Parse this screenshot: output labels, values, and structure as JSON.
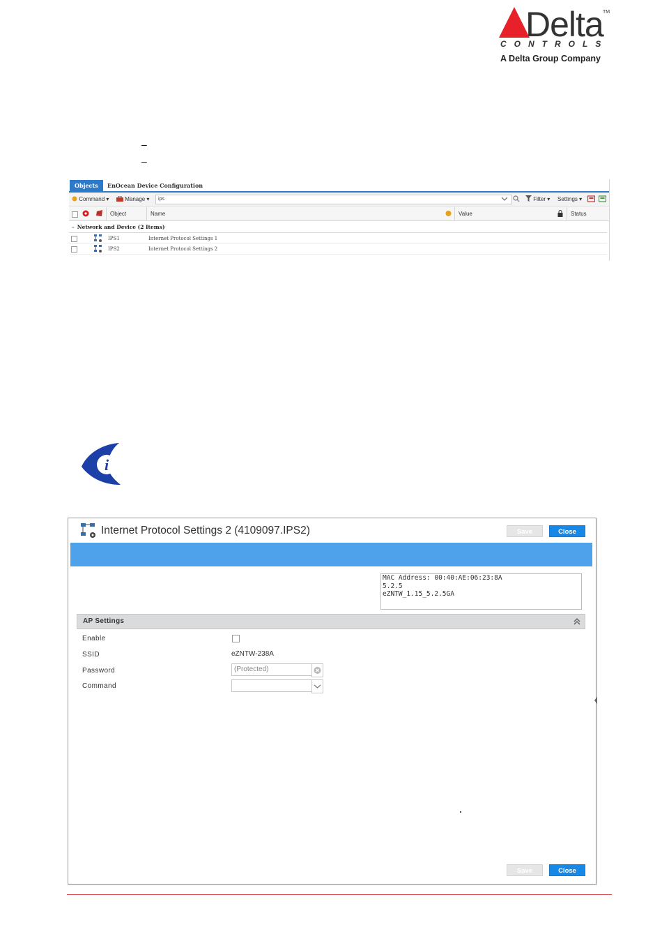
{
  "logo": {
    "brand": "Delta",
    "trademark": "TM",
    "subtitle": "CONTROLS",
    "company": "A Delta Group Company",
    "accent_color": "#e8202a"
  },
  "dashes": [
    "–",
    "–"
  ],
  "object_list": {
    "tabs": [
      {
        "label": "Objects",
        "active": true
      },
      {
        "label": "EnOcean Device Configuration",
        "active": false
      }
    ],
    "toolbar": {
      "command_label": "Command",
      "manage_label": "Manage",
      "search_value": "ips",
      "filter_label": "Filter",
      "settings_label": "Settings"
    },
    "columns": {
      "object": "Object",
      "name": "Name",
      "value": "Value",
      "status": "Status"
    },
    "group_label": "Network and Device (2 Items)",
    "rows": [
      {
        "object": "IPS1",
        "name": "Internet Protocol Settings 1"
      },
      {
        "object": "IPS2",
        "name": "Internet Protocol Settings 2"
      }
    ]
  },
  "info_icon": "info-icon",
  "dialog": {
    "title": "Internet Protocol Settings 2 (4109097.IPS2)",
    "save_label": "Save",
    "close_label": "Close",
    "info_lines": [
      "MAC Address: 00:40:AE:06:23:8A",
      "5.2.5",
      "eZNTW_1.15_5.2.5GA"
    ],
    "section_title": "AP Settings",
    "fields": {
      "enable_label": "Enable",
      "ssid_label": "SSID",
      "ssid_value": "eZNTW-238A",
      "password_label": "Password",
      "password_value": "(Protected)",
      "command_label": "Command",
      "command_value": ""
    },
    "accent_color": "#1888e6",
    "bar_color": "#4ea2ec"
  }
}
